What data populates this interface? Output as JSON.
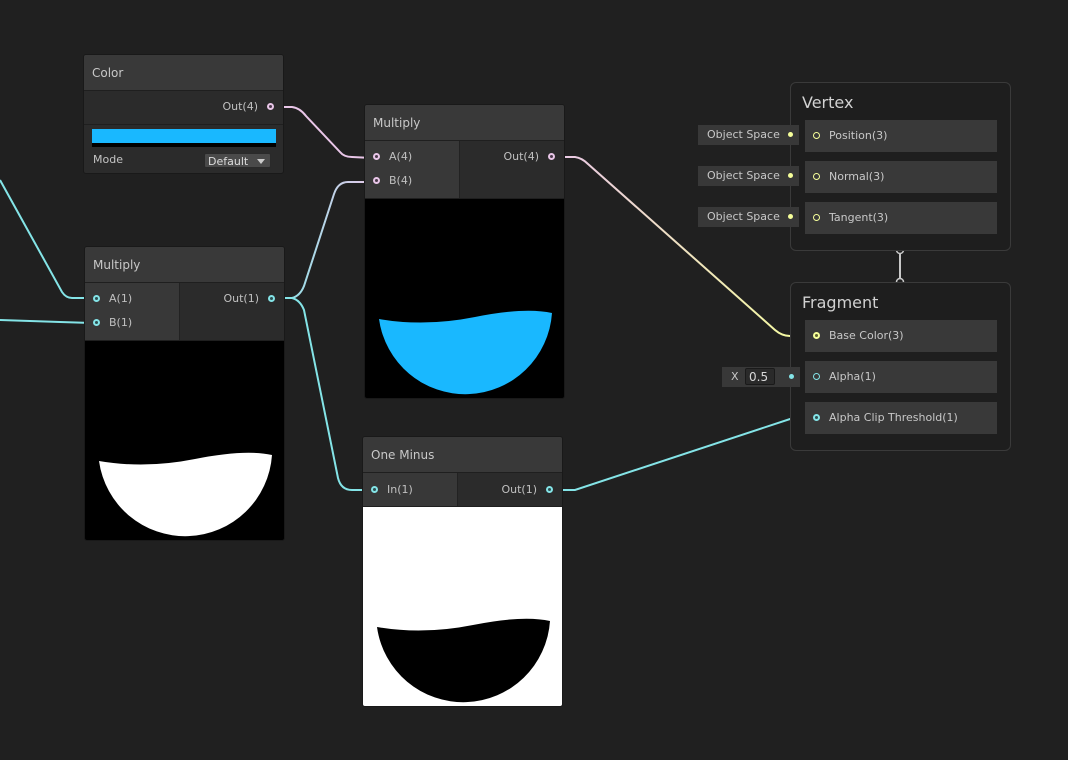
{
  "colors": {
    "vector4": "#e9c6e8",
    "vector1": "#84e4e7",
    "vector3": "#f6ff9a",
    "swatch": "#19b8ff"
  },
  "color_node": {
    "title": "Color",
    "out": "Out(4)",
    "mode_label": "Mode",
    "mode_value": "Default",
    "swatch_color": "#19b8ff",
    "dropdown_icon": "triangle-down"
  },
  "multiply_left": {
    "title": "Multiply",
    "in_a": "A(1)",
    "in_b": "B(1)",
    "out": "Out(1)"
  },
  "multiply_right": {
    "title": "Multiply",
    "in_a": "A(4)",
    "in_b": "B(4)",
    "out": "Out(4)"
  },
  "one_minus": {
    "title": "One Minus",
    "in": "In(1)",
    "out": "Out(1)"
  },
  "vertex": {
    "title": "Vertex",
    "slots": [
      {
        "label": "Position(3)",
        "default": "Object Space"
      },
      {
        "label": "Normal(3)",
        "default": "Object Space"
      },
      {
        "label": "Tangent(3)",
        "default": "Object Space"
      }
    ]
  },
  "fragment": {
    "title": "Fragment",
    "slots": [
      {
        "label": "Base Color(3)"
      },
      {
        "label": "Alpha(1)",
        "default_axis": "X",
        "default_value": "0.5"
      },
      {
        "label": "Alpha Clip Threshold(1)"
      }
    ]
  }
}
